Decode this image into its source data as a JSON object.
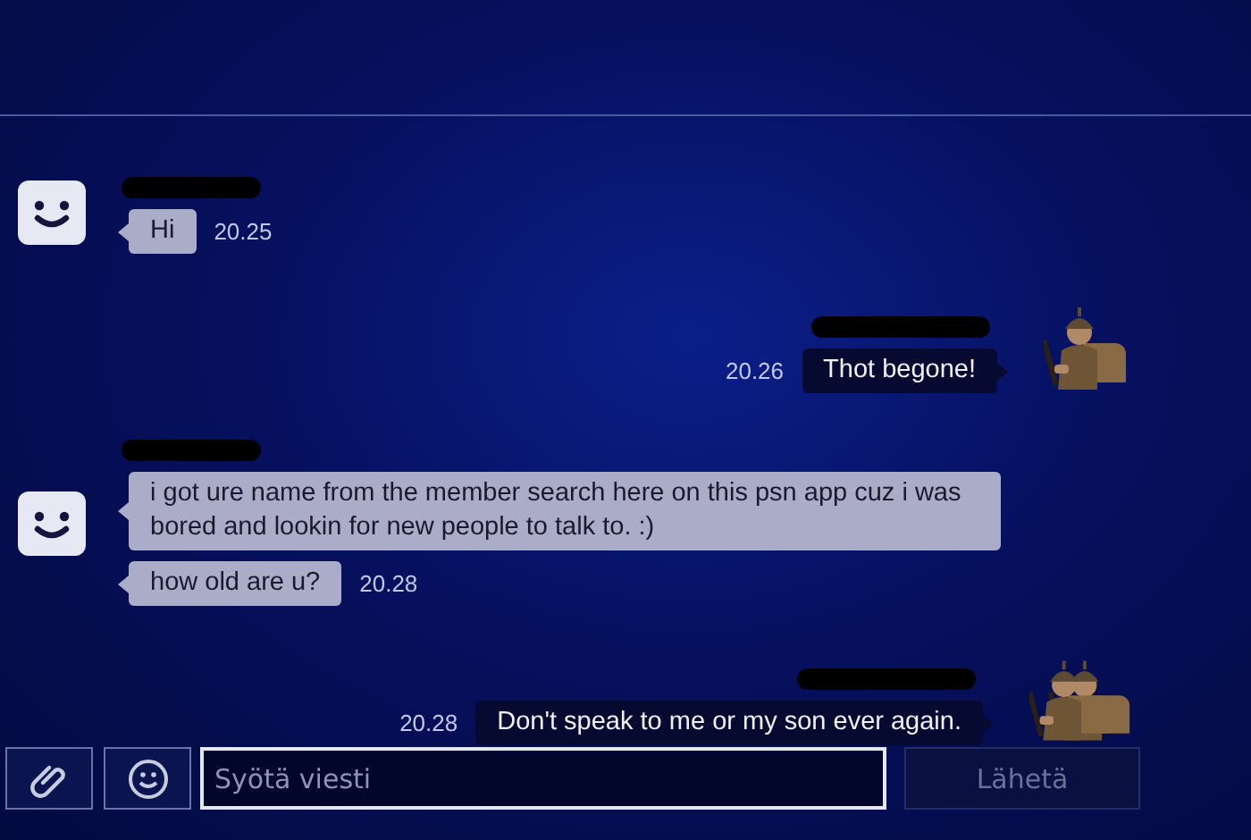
{
  "conversation": [
    {
      "kind": "incoming",
      "avatar": {
        "kind": "face"
      },
      "name_redacted": true,
      "messages": [
        {
          "text": "Hi",
          "time": "20.25"
        }
      ]
    },
    {
      "kind": "outgoing",
      "avatar": {
        "kind": "soldier"
      },
      "name_redacted": true,
      "messages": [
        {
          "text": "Thot begone!",
          "time": "20.26"
        }
      ]
    },
    {
      "kind": "incoming",
      "avatar": {
        "kind": "face"
      },
      "name_redacted": true,
      "messages": [
        {
          "text": "i got ure name from the member search here on this psn app cuz i was bored and lookin for new people to talk to. :)"
        },
        {
          "text": "how old are u?",
          "time": "20.28"
        }
      ]
    },
    {
      "kind": "outgoing",
      "avatar": {
        "kind": "two_soldiers"
      },
      "name_redacted": true,
      "messages": [
        {
          "text": "Don't speak to me or my son ever again.",
          "time": "20.28"
        }
      ]
    }
  ],
  "composer": {
    "placeholder": "Syötä viesti",
    "send_label": "Lähetä",
    "send_disabled": true
  }
}
